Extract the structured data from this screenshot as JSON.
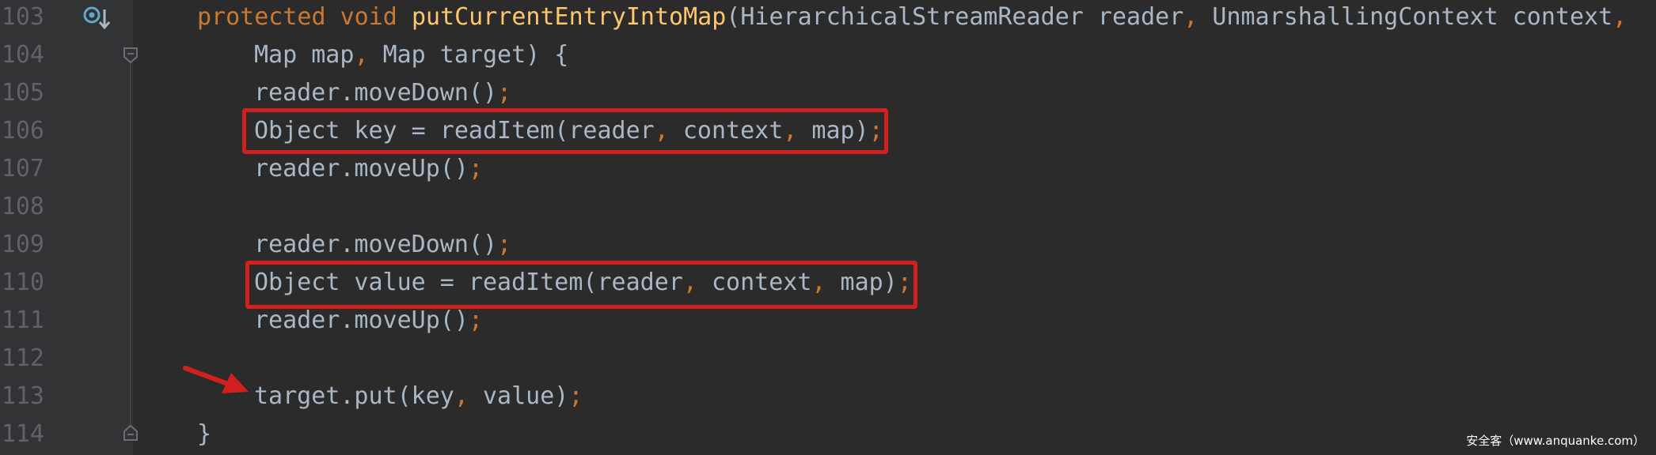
{
  "colors": {
    "background": "#2b2b2b",
    "gutter": "#313335",
    "line_number": "#606366",
    "default_text": "#a9b7c6",
    "keyword": "#cc7832",
    "method_name": "#ffc66d",
    "highlight_box": "#d2201f",
    "arrow": "#d2201f"
  },
  "gutter_icons": {
    "override": "override-implements-icon",
    "fold_open": "fold-open-icon",
    "fold_close": "fold-close-icon"
  },
  "lines": [
    {
      "num": "103"
    },
    {
      "num": "104"
    },
    {
      "num": "105"
    },
    {
      "num": "106"
    },
    {
      "num": "107"
    },
    {
      "num": "108"
    },
    {
      "num": "109"
    },
    {
      "num": "110"
    },
    {
      "num": "111"
    },
    {
      "num": "112"
    },
    {
      "num": "113"
    },
    {
      "num": "114"
    }
  ],
  "code": {
    "l103": {
      "kw_protected": "protected",
      "kw_void": "void",
      "method": "putCurrentEntryIntoMap",
      "open": "(",
      "p1_type": "HierarchicalStreamReader",
      "p1_name": "reader",
      "comma1": ",",
      "p2_type": "UnmarshallingContext",
      "p2_name": "context",
      "comma2": ","
    },
    "l104": {
      "p3": "Map map",
      "comma": ",",
      "p4": "Map target) {"
    },
    "l105": {
      "text": "reader.moveDown()",
      "semi": ";"
    },
    "l106": {
      "a": "Object key = readItem(reader",
      "c1": ",",
      "b": " context",
      "c2": ",",
      "c": " map)",
      "semi": ";"
    },
    "l107": {
      "text": "reader.moveUp()",
      "semi": ";"
    },
    "l109": {
      "text": "reader.moveDown()",
      "semi": ";"
    },
    "l110": {
      "a": "Object value = readItem(reader",
      "c1": ",",
      "b": " context",
      "c2": ",",
      "c": " map)",
      "semi": ";"
    },
    "l111": {
      "text": "reader.moveUp()",
      "semi": ";"
    },
    "l113": {
      "a": "target.put(key",
      "comma": ",",
      "b": " value)",
      "semi": ";"
    },
    "l114": {
      "text": "}"
    }
  },
  "watermark": "安全客（www.anquanke.com）"
}
